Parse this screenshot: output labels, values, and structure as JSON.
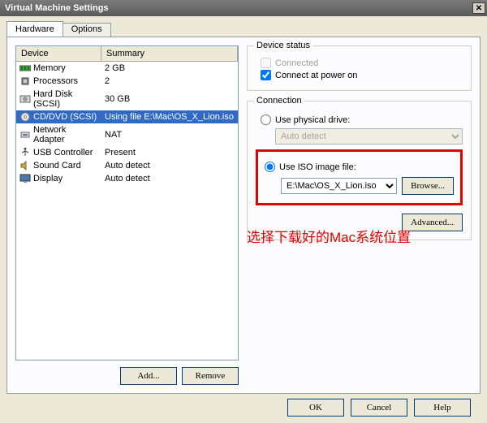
{
  "title": "Virtual Machine Settings",
  "tabs": {
    "hardware": "Hardware",
    "options": "Options"
  },
  "headers": {
    "device": "Device",
    "summary": "Summary"
  },
  "devices": [
    {
      "name": "Memory",
      "summary": "2 GB",
      "icon": "mem"
    },
    {
      "name": "Processors",
      "summary": "2",
      "icon": "cpu"
    },
    {
      "name": "Hard Disk (SCSI)",
      "summary": "30 GB",
      "icon": "hdd"
    },
    {
      "name": "CD/DVD (SCSI)",
      "summary": "Using file E:\\Mac\\OS_X_Lion.iso",
      "icon": "cd"
    },
    {
      "name": "Network Adapter",
      "summary": "NAT",
      "icon": "net"
    },
    {
      "name": "USB Controller",
      "summary": "Present",
      "icon": "usb"
    },
    {
      "name": "Sound Card",
      "summary": "Auto detect",
      "icon": "snd"
    },
    {
      "name": "Display",
      "summary": "Auto detect",
      "icon": "disp"
    }
  ],
  "buttons": {
    "add": "Add...",
    "remove": "Remove",
    "browse": "Browse...",
    "advanced": "Advanced...",
    "ok": "OK",
    "cancel": "Cancel",
    "help": "Help"
  },
  "groups": {
    "status": "Device status",
    "connection": "Connection"
  },
  "status": {
    "connected": "Connected",
    "poweron": "Connect at power on"
  },
  "conn": {
    "physical": "Use physical drive:",
    "autodetect": "Auto detect",
    "iso": "Use ISO image file:",
    "path": "E:\\Mac\\OS_X_Lion.iso"
  },
  "annotation": "选择下载好的Mac系统位置",
  "close": "✕"
}
